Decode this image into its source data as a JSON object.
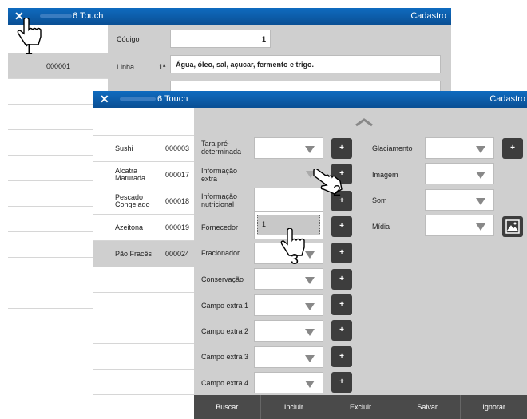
{
  "back": {
    "title": "6 Touch",
    "cadastro": "Cadastro",
    "list_item": "000001",
    "codigo_label": "Código",
    "codigo_value": "1",
    "linha_label": "Linha",
    "linha_marker": "1ª",
    "linha_value": "Água, óleo, sal, açucar, fermento e trigo."
  },
  "front": {
    "title": "6 Touch",
    "cadastro": "Cadastro",
    "items": [
      {
        "name": "Sushi",
        "code": "000003"
      },
      {
        "name": "Alcatra Maturada",
        "code": "000017"
      },
      {
        "name": "Pescado Congelado",
        "code": "000018"
      },
      {
        "name": "Azeitona",
        "code": "000019"
      },
      {
        "name": "Pão Fracês",
        "code": "000024"
      }
    ],
    "fields_left": [
      "Tara pré-determinada",
      "Informação extra",
      "Informação nutricional",
      "Fornecedor",
      "Fracionador",
      "Conservação",
      "Campo extra 1",
      "Campo extra 2",
      "Campo extra 3",
      "Campo extra 4"
    ],
    "fornecedor_value": "1",
    "plus": "+",
    "fields_right": [
      "Glaciamento",
      "Imagem",
      "Som",
      "Mídia"
    ],
    "buttons": [
      "Buscar",
      "Incluir",
      "Excluir",
      "Salvar",
      "Ignorar"
    ]
  },
  "steps": [
    "1",
    "2",
    "3"
  ],
  "close_glyph": "✕"
}
